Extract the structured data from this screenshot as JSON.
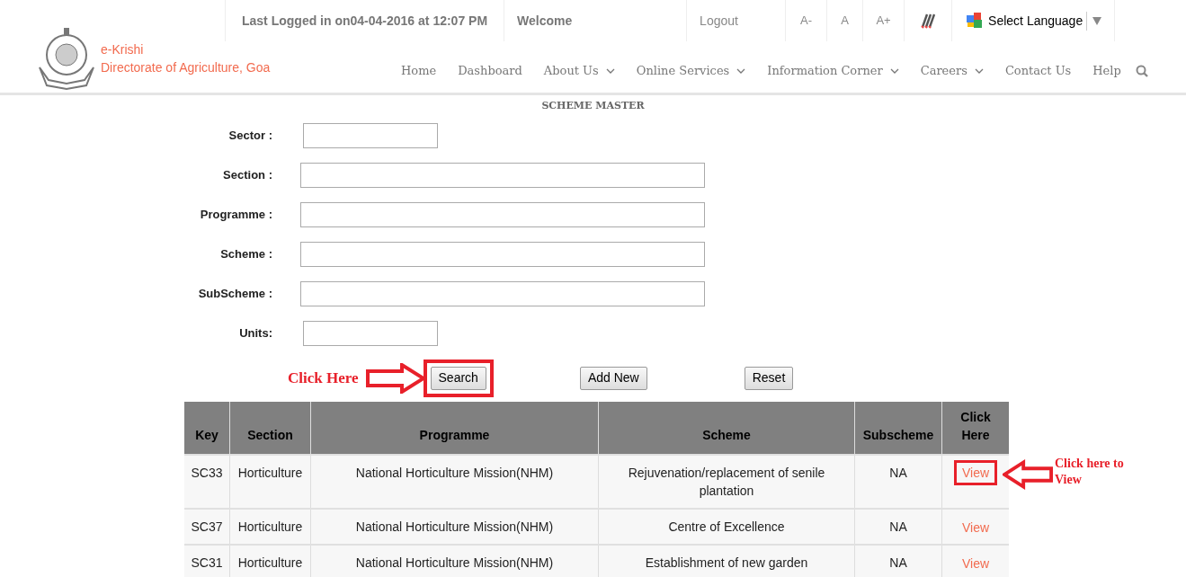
{
  "top_bar": {
    "last_login": "Last Logged in on04-04-2016 at 12:07 PM",
    "welcome": "Welcome",
    "logout": "Logout",
    "font_sizes": [
      "A-",
      "A",
      "A+"
    ],
    "language": "Select Language"
  },
  "brand": {
    "line1": "e-Krishi",
    "line2": "Directorate of Agriculture, Goa"
  },
  "nav": [
    {
      "label": "Home",
      "dropdown": false
    },
    {
      "label": "Dashboard",
      "dropdown": false
    },
    {
      "label": "About Us",
      "dropdown": true
    },
    {
      "label": "Online Services",
      "dropdown": true
    },
    {
      "label": "Information Corner",
      "dropdown": true
    },
    {
      "label": "Careers",
      "dropdown": true
    },
    {
      "label": "Contact Us",
      "dropdown": false
    },
    {
      "label": "Help",
      "dropdown": false
    }
  ],
  "page_title": "SCHEME MASTER",
  "fields": [
    {
      "label": "Sector :",
      "kind": "short"
    },
    {
      "label": "Section :",
      "kind": "long"
    },
    {
      "label": "Programme :",
      "kind": "long"
    },
    {
      "label": "Scheme :",
      "kind": "long"
    },
    {
      "label": "SubScheme :",
      "kind": "long"
    },
    {
      "label": "Units:",
      "kind": "short"
    }
  ],
  "buttons": [
    "Search",
    "Add New",
    "Reset"
  ],
  "annotations": {
    "search_hint": "Click Here",
    "view_hint": "Click here to View"
  },
  "table": {
    "columns": [
      "Key",
      "Section",
      "Programme",
      "Scheme",
      "Subscheme",
      "Click Here"
    ],
    "rows": [
      {
        "cells": [
          "SC33",
          "Horticulture",
          "National Horticulture Mission(NHM)",
          "Rejuvenation/replacement of senile plantation",
          "NA"
        ],
        "link": "View"
      },
      {
        "cells": [
          "SC37",
          "Horticulture",
          "National Horticulture Mission(NHM)",
          "Centre of Excellence",
          "NA"
        ],
        "link": "View"
      },
      {
        "cells": [
          "SC31",
          "Horticulture",
          "National Horticulture Mission(NHM)",
          "Establishment of new garden",
          "NA"
        ],
        "link": "View"
      }
    ]
  }
}
